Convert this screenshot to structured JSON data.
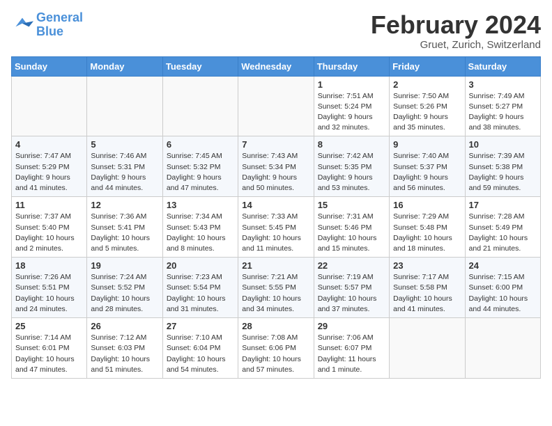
{
  "header": {
    "logo": {
      "line1": "General",
      "line2": "Blue"
    },
    "title": "February 2024",
    "location": "Gruet, Zurich, Switzerland"
  },
  "days_of_week": [
    "Sunday",
    "Monday",
    "Tuesday",
    "Wednesday",
    "Thursday",
    "Friday",
    "Saturday"
  ],
  "weeks": [
    [
      {
        "day": "",
        "info": ""
      },
      {
        "day": "",
        "info": ""
      },
      {
        "day": "",
        "info": ""
      },
      {
        "day": "",
        "info": ""
      },
      {
        "day": "1",
        "info": "Sunrise: 7:51 AM\nSunset: 5:24 PM\nDaylight: 9 hours\nand 32 minutes."
      },
      {
        "day": "2",
        "info": "Sunrise: 7:50 AM\nSunset: 5:26 PM\nDaylight: 9 hours\nand 35 minutes."
      },
      {
        "day": "3",
        "info": "Sunrise: 7:49 AM\nSunset: 5:27 PM\nDaylight: 9 hours\nand 38 minutes."
      }
    ],
    [
      {
        "day": "4",
        "info": "Sunrise: 7:47 AM\nSunset: 5:29 PM\nDaylight: 9 hours\nand 41 minutes."
      },
      {
        "day": "5",
        "info": "Sunrise: 7:46 AM\nSunset: 5:31 PM\nDaylight: 9 hours\nand 44 minutes."
      },
      {
        "day": "6",
        "info": "Sunrise: 7:45 AM\nSunset: 5:32 PM\nDaylight: 9 hours\nand 47 minutes."
      },
      {
        "day": "7",
        "info": "Sunrise: 7:43 AM\nSunset: 5:34 PM\nDaylight: 9 hours\nand 50 minutes."
      },
      {
        "day": "8",
        "info": "Sunrise: 7:42 AM\nSunset: 5:35 PM\nDaylight: 9 hours\nand 53 minutes."
      },
      {
        "day": "9",
        "info": "Sunrise: 7:40 AM\nSunset: 5:37 PM\nDaylight: 9 hours\nand 56 minutes."
      },
      {
        "day": "10",
        "info": "Sunrise: 7:39 AM\nSunset: 5:38 PM\nDaylight: 9 hours\nand 59 minutes."
      }
    ],
    [
      {
        "day": "11",
        "info": "Sunrise: 7:37 AM\nSunset: 5:40 PM\nDaylight: 10 hours\nand 2 minutes."
      },
      {
        "day": "12",
        "info": "Sunrise: 7:36 AM\nSunset: 5:41 PM\nDaylight: 10 hours\nand 5 minutes."
      },
      {
        "day": "13",
        "info": "Sunrise: 7:34 AM\nSunset: 5:43 PM\nDaylight: 10 hours\nand 8 minutes."
      },
      {
        "day": "14",
        "info": "Sunrise: 7:33 AM\nSunset: 5:45 PM\nDaylight: 10 hours\nand 11 minutes."
      },
      {
        "day": "15",
        "info": "Sunrise: 7:31 AM\nSunset: 5:46 PM\nDaylight: 10 hours\nand 15 minutes."
      },
      {
        "day": "16",
        "info": "Sunrise: 7:29 AM\nSunset: 5:48 PM\nDaylight: 10 hours\nand 18 minutes."
      },
      {
        "day": "17",
        "info": "Sunrise: 7:28 AM\nSunset: 5:49 PM\nDaylight: 10 hours\nand 21 minutes."
      }
    ],
    [
      {
        "day": "18",
        "info": "Sunrise: 7:26 AM\nSunset: 5:51 PM\nDaylight: 10 hours\nand 24 minutes."
      },
      {
        "day": "19",
        "info": "Sunrise: 7:24 AM\nSunset: 5:52 PM\nDaylight: 10 hours\nand 28 minutes."
      },
      {
        "day": "20",
        "info": "Sunrise: 7:23 AM\nSunset: 5:54 PM\nDaylight: 10 hours\nand 31 minutes."
      },
      {
        "day": "21",
        "info": "Sunrise: 7:21 AM\nSunset: 5:55 PM\nDaylight: 10 hours\nand 34 minutes."
      },
      {
        "day": "22",
        "info": "Sunrise: 7:19 AM\nSunset: 5:57 PM\nDaylight: 10 hours\nand 37 minutes."
      },
      {
        "day": "23",
        "info": "Sunrise: 7:17 AM\nSunset: 5:58 PM\nDaylight: 10 hours\nand 41 minutes."
      },
      {
        "day": "24",
        "info": "Sunrise: 7:15 AM\nSunset: 6:00 PM\nDaylight: 10 hours\nand 44 minutes."
      }
    ],
    [
      {
        "day": "25",
        "info": "Sunrise: 7:14 AM\nSunset: 6:01 PM\nDaylight: 10 hours\nand 47 minutes."
      },
      {
        "day": "26",
        "info": "Sunrise: 7:12 AM\nSunset: 6:03 PM\nDaylight: 10 hours\nand 51 minutes."
      },
      {
        "day": "27",
        "info": "Sunrise: 7:10 AM\nSunset: 6:04 PM\nDaylight: 10 hours\nand 54 minutes."
      },
      {
        "day": "28",
        "info": "Sunrise: 7:08 AM\nSunset: 6:06 PM\nDaylight: 10 hours\nand 57 minutes."
      },
      {
        "day": "29",
        "info": "Sunrise: 7:06 AM\nSunset: 6:07 PM\nDaylight: 11 hours\nand 1 minute."
      },
      {
        "day": "",
        "info": ""
      },
      {
        "day": "",
        "info": ""
      }
    ]
  ]
}
